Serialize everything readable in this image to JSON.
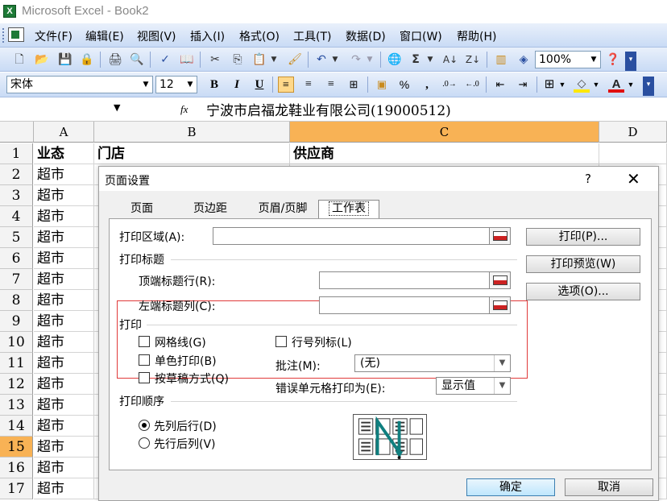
{
  "window": {
    "title": "Microsoft Excel - Book2",
    "app_icon": "X"
  },
  "menu": [
    "文件(F)",
    "编辑(E)",
    "视图(V)",
    "插入(I)",
    "格式(O)",
    "工具(T)",
    "数据(D)",
    "窗口(W)",
    "帮助(H)"
  ],
  "toolbar": {
    "zoom": "100%",
    "font": "宋体",
    "font_size": "12",
    "bold": "B",
    "italic": "I",
    "underline": "U",
    "sigma": "Σ",
    "percent": "%",
    "comma": ",",
    "color_a": "A"
  },
  "formula_bar": {
    "fx": "fx",
    "content": "宁波市启福龙鞋业有限公司(19000512)"
  },
  "grid": {
    "columns": [
      "A",
      "B",
      "C",
      "D"
    ],
    "rows": [
      "1",
      "2",
      "3",
      "4",
      "5",
      "6",
      "7",
      "8",
      "9",
      "10",
      "11",
      "12",
      "13",
      "14",
      "15",
      "16",
      "17"
    ],
    "header_row": [
      "业态",
      "门店",
      "供应商"
    ],
    "col_a_values": [
      "超市",
      "超市",
      "超市",
      "超市",
      "超市",
      "超市",
      "超市",
      "超市",
      "超市",
      "超市",
      "超市",
      "超市",
      "超市",
      "超市",
      "超市",
      "超市"
    ]
  },
  "dialog": {
    "title": "页面设置",
    "help": "?",
    "close": "✕",
    "tabs": [
      "页面",
      "页边距",
      "页眉/页脚",
      "工作表"
    ],
    "print_area_label": "打印区域(A):",
    "print_titles_group": "打印标题",
    "top_rows_label": "顶端标题行(R):",
    "left_cols_label": "左端标题列(C):",
    "print_group": "打印",
    "gridlines": "网格线(G)",
    "mono": "单色打印(B)",
    "draft": "按草稿方式(Q)",
    "row_col_headings": "行号列标(L)",
    "comments_label": "批注(M):",
    "comments_value": "(无)",
    "errors_label": "错误单元格打印为(E):",
    "errors_value": "显示值",
    "order_group": "打印顺序",
    "down_then_over": "先列后行(D)",
    "over_then_down": "先行后列(V)",
    "btn_print": "打印(P)...",
    "btn_preview": "打印预览(W)",
    "btn_options": "选项(O)...",
    "btn_ok": "确定",
    "btn_cancel": "取消"
  }
}
